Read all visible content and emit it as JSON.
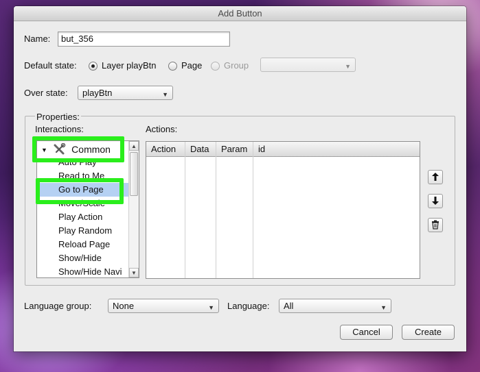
{
  "window": {
    "title": "Add Button"
  },
  "name_field": {
    "label": "Name:",
    "value": "but_356"
  },
  "default_state": {
    "label": "Default state:",
    "options": [
      {
        "label": "Layer playBtn",
        "checked": true,
        "enabled": true
      },
      {
        "label": "Page",
        "checked": false,
        "enabled": true
      },
      {
        "label": "Group",
        "checked": false,
        "enabled": false
      }
    ],
    "group_select_value": ""
  },
  "over_state": {
    "label": "Over state:",
    "value": "playBtn"
  },
  "properties": {
    "label": "Properties:",
    "interactions_label": "Interactions:",
    "actions_label": "Actions:",
    "tree": {
      "category": "Common",
      "items": [
        "Auto Play",
        "Read to Me",
        "Go to Page",
        "Move/Scale",
        "Play Action",
        "Play Random",
        "Reload Page",
        "Show/Hide",
        "Show/Hide Navi"
      ],
      "selected_index": 2
    },
    "actions_table": {
      "columns": [
        "Action",
        "Data",
        "Param",
        "id"
      ],
      "rows": []
    },
    "side_buttons": [
      {
        "icon": "arrow-up-icon",
        "glyph": "🡑"
      },
      {
        "icon": "arrow-down-icon",
        "glyph": "🡓"
      },
      {
        "icon": "trash-icon",
        "glyph": "🗑"
      }
    ],
    "highlight_color": "#2aee1c"
  },
  "language_group": {
    "label": "Language group:",
    "value": "None"
  },
  "language": {
    "label": "Language:",
    "value": "All"
  },
  "buttons": {
    "cancel": "Cancel",
    "create": "Create"
  }
}
